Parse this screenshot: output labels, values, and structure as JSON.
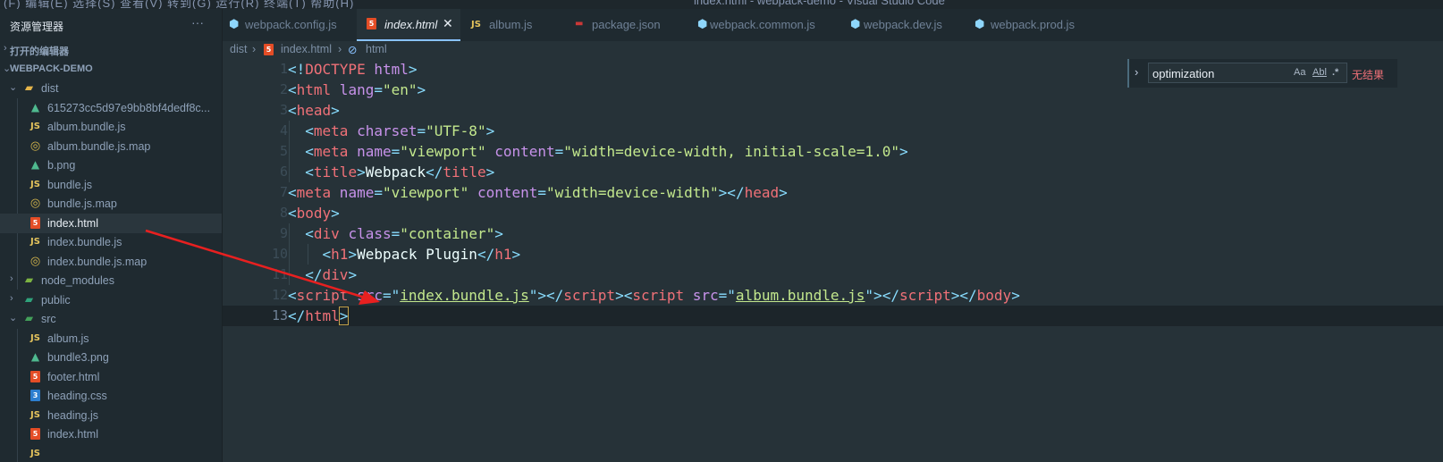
{
  "menubar": {
    "menus": "(F) 编辑(E) 选择(S) 查看(V) 转到(G) 运行(R) 终端(T) 帮助(H)",
    "window_title": "index.html - webpack-demo - Visual Studio Code"
  },
  "sidebar": {
    "title": "资源管理器",
    "more": "···",
    "open_editors": "打开的编辑器",
    "project": "WEBPACK-DEMO",
    "items": [
      {
        "label": "dist",
        "icon": "folder-open-icon"
      },
      {
        "label": "615273cc5d97e9bb8bf4dedf8c...",
        "icon": "image-icon"
      },
      {
        "label": "album.bundle.js",
        "icon": "js-icon"
      },
      {
        "label": "album.bundle.js.map",
        "icon": "map-icon"
      },
      {
        "label": "b.png",
        "icon": "image-icon"
      },
      {
        "label": "bundle.js",
        "icon": "js-icon"
      },
      {
        "label": "bundle.js.map",
        "icon": "map-icon"
      },
      {
        "label": "index.html",
        "icon": "html-icon"
      },
      {
        "label": "index.bundle.js",
        "icon": "js-icon"
      },
      {
        "label": "index.bundle.js.map",
        "icon": "map-icon"
      },
      {
        "label": "node_modules",
        "icon": "node-folder-icon"
      },
      {
        "label": "public",
        "icon": "public-folder-icon"
      },
      {
        "label": "src",
        "icon": "src-folder-icon"
      },
      {
        "label": "album.js",
        "icon": "js-icon"
      },
      {
        "label": "bundle3.png",
        "icon": "image-icon"
      },
      {
        "label": "footer.html",
        "icon": "html-icon"
      },
      {
        "label": "heading.css",
        "icon": "css-icon"
      },
      {
        "label": "heading.js",
        "icon": "js-icon"
      },
      {
        "label": "index.html",
        "icon": "html-icon"
      }
    ]
  },
  "tabs": [
    {
      "label": "webpack.config.js",
      "icon": "webpack-icon"
    },
    {
      "label": "index.html",
      "icon": "html-icon",
      "active": true
    },
    {
      "label": "album.js",
      "icon": "js-icon"
    },
    {
      "label": "package.json",
      "icon": "npm-icon"
    },
    {
      "label": "webpack.common.js",
      "icon": "webpack-icon"
    },
    {
      "label": "webpack.dev.js",
      "icon": "webpack-icon"
    },
    {
      "label": "webpack.prod.js",
      "icon": "webpack-icon"
    }
  ],
  "close_glyph": "✕",
  "breadcrumb": {
    "dist": "dist",
    "sep1": "›",
    "file": "index.html",
    "sep2": "›",
    "node": "html"
  },
  "find": {
    "query": "optimization",
    "match_case": "Aa",
    "whole_word": "Abl",
    "regex": ".*",
    "result": "无结果"
  },
  "editor": {
    "line_numbers": [
      "1",
      "2",
      "3",
      "4",
      "5",
      "6",
      "7",
      "8",
      "9",
      "10",
      "11",
      "12",
      "13"
    ],
    "current_line": 13,
    "l1": {
      "p1": "<!",
      "t1": "DOCTYPE",
      "x1": " ",
      "a1": "html",
      "p2": ">"
    },
    "l2": {
      "p1": "<",
      "t1": "html",
      "a1": " lang",
      "p2": "=",
      "s1": "\"en\"",
      "p3": ">"
    },
    "l3": {
      "p1": "<",
      "t1": "head",
      "p2": ">"
    },
    "l4": {
      "p1": "<",
      "t1": "meta",
      "a1": " charset",
      "p2": "=",
      "s1": "\"UTF-8\"",
      "p3": ">"
    },
    "l5": {
      "p1": "<",
      "t1": "meta",
      "a1": " name",
      "p2": "=",
      "s1": "\"viewport\"",
      "a2": " content",
      "p3": "=",
      "s2": "\"width=device-width, initial-scale=1.0\"",
      "p4": ">"
    },
    "l6": {
      "p1": "<",
      "t1": "title",
      "p2": ">",
      "x1": "Webpack",
      "p3": "</",
      "t2": "title",
      "p4": ">"
    },
    "l7": {
      "p1": "<",
      "t1": "meta",
      "a1": " name",
      "p2": "=",
      "s1": "\"viewport\"",
      "a2": " content",
      "p3": "=",
      "s2": "\"width=device-width\"",
      "p4": "></",
      "t2": "head",
      "p5": ">"
    },
    "l8": {
      "p1": "<",
      "t1": "body",
      "p2": ">"
    },
    "l9": {
      "p1": "<",
      "t1": "div",
      "a1": " class",
      "p2": "=",
      "s1": "\"container\"",
      "p3": ">"
    },
    "l10": {
      "p1": "<",
      "t1": "h1",
      "p2": ">",
      "x1": "Webpack Plugin",
      "p3": "</",
      "t2": "h1",
      "p4": ">"
    },
    "l11": {
      "p1": "</",
      "t1": "div",
      "p2": ">"
    },
    "l12": {
      "p1": "<",
      "t1": "script",
      "a1": " src",
      "p2": "=\"",
      "s1": "index.bundle.js",
      "p3": "\"></",
      "t2": "script",
      "p4": "><",
      "t3": "script",
      "a2": " src",
      "p5": "=\"",
      "s2": "album.bundle.js",
      "p6": "\"></",
      "t4": "script",
      "p7": "></",
      "t5": "body",
      "p8": ">"
    },
    "l13": {
      "p1": "</",
      "t1": "html",
      "p2": ">"
    }
  },
  "colors": {
    "background": "#263238",
    "sidebar": "#1f2a30",
    "tag": "#f07178",
    "attribute": "#c792ea",
    "string": "#c3e88d",
    "punctuation": "#89ddff",
    "annotation_arrow": "#e82020"
  }
}
